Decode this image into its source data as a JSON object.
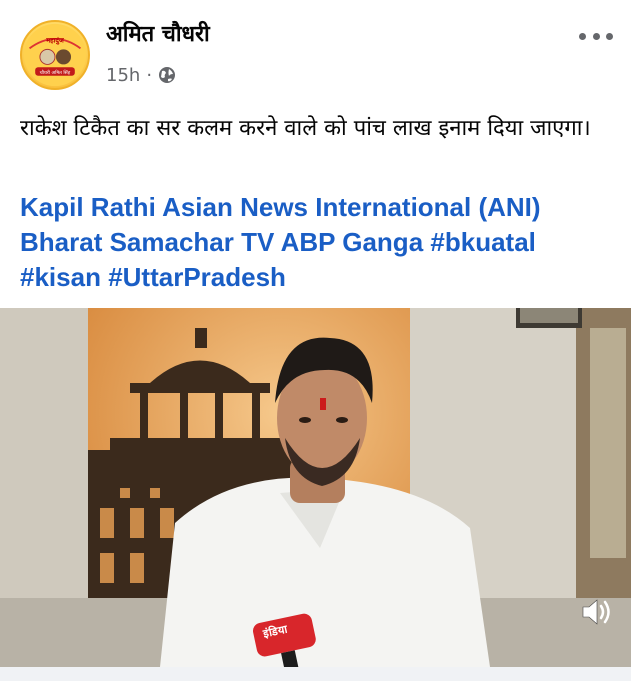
{
  "post": {
    "author": "अमित चौधरी",
    "time": "15h",
    "separator": "·",
    "privacy_icon": "globe-icon",
    "more_icon": "more-options-icon",
    "text": "राकेश टिकैत का सर कलम करने वाले को पांच लाख इनाम दिया जाएगा।",
    "tags": [
      "Kapil Rathi",
      "Asian News International (ANI)",
      "Bharat Samachar TV",
      "ABP Ganga",
      "#bkuatal",
      "#kisan",
      "#UttarPradesh"
    ],
    "avatar_label_top": "महादुंज",
    "avatar_label_bottom": "चौधरी अमित सिंह"
  },
  "video": {
    "mic_label": "इंडिया",
    "sound_icon": "volume-icon"
  },
  "colors": {
    "link": "#1a5ec5",
    "meta": "#65676b",
    "text": "#050505"
  }
}
